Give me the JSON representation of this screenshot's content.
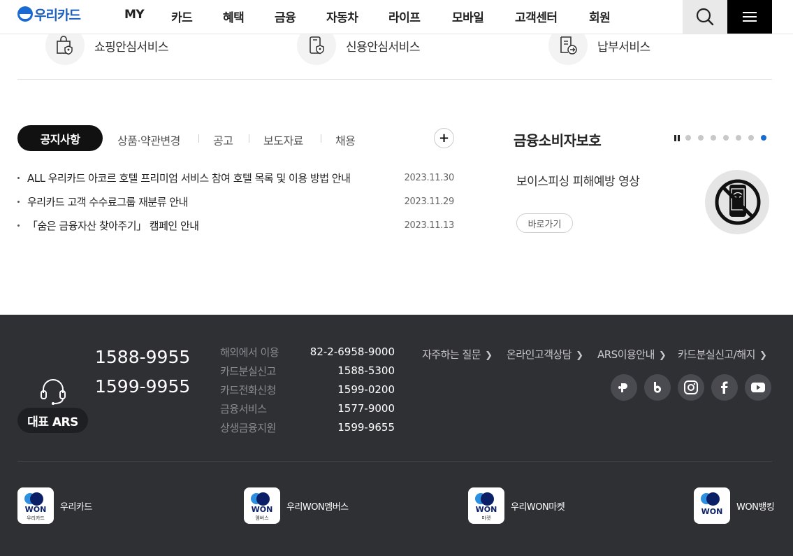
{
  "header": {
    "logo_text": "우리카드",
    "nav": [
      "MY",
      "카드",
      "혜택",
      "금융",
      "자동차",
      "라이프",
      "모바일",
      "고객센터",
      "회원"
    ]
  },
  "services": [
    "쇼핑안심서비스",
    "신용안심서비스",
    "납부서비스"
  ],
  "notice": {
    "tabs": [
      "공지사항",
      "상품·약관변경",
      "공고",
      "보도자료",
      "채용"
    ],
    "more_label": "+",
    "items": [
      {
        "title": "ALL 우리카드 아코르 호텔 프리미엄 서비스 참여 호텔 목록 및 이용 방법 안내",
        "date": "2023.11.30"
      },
      {
        "title": "우리카드 고객 수수료그룹 재분류 안내",
        "date": "2023.11.29"
      },
      {
        "title": "「숨은 금융자산 찾아주기」 캠페인 안내",
        "date": "2023.11.13"
      }
    ]
  },
  "consumer": {
    "title": "금융소비자보호",
    "text": "보이스피싱 피해예방 영상",
    "button": "바로가기",
    "slide_count": 7,
    "active_slide": 7
  },
  "footer": {
    "ars_badge": "대표 ARS",
    "phones": [
      "1588-9955",
      "1599-9955"
    ],
    "tel_rows": [
      {
        "label": "해외에서 이용",
        "num": "82-2-6958-9000"
      },
      {
        "label": "카드분실신고",
        "num": "1588-5300"
      },
      {
        "label": "카드전화신청",
        "num": "1599-0200"
      },
      {
        "label": "금융서비스",
        "num": "1577-9000"
      },
      {
        "label": "상생금융지원",
        "num": "1599-9655"
      }
    ],
    "links": [
      "자주하는 질문",
      "온라인고객상담",
      "ARS이용안내",
      "카드분실신고/해지"
    ],
    "sns": [
      "pay-icon",
      "blog-icon",
      "instagram-icon",
      "facebook-icon",
      "youtube-icon"
    ],
    "apps": [
      {
        "label": "우리카드",
        "icon_text": "WON",
        "icon_sub": "우리카드"
      },
      {
        "label": "우리WON멤버스",
        "icon_text": "WON",
        "icon_sub": "멤버스"
      },
      {
        "label": "우리WON마켓",
        "icon_text": "WON",
        "icon_sub": "마켓"
      },
      {
        "label": "WON뱅킹",
        "icon_text": "WON",
        "icon_sub": ""
      }
    ]
  }
}
